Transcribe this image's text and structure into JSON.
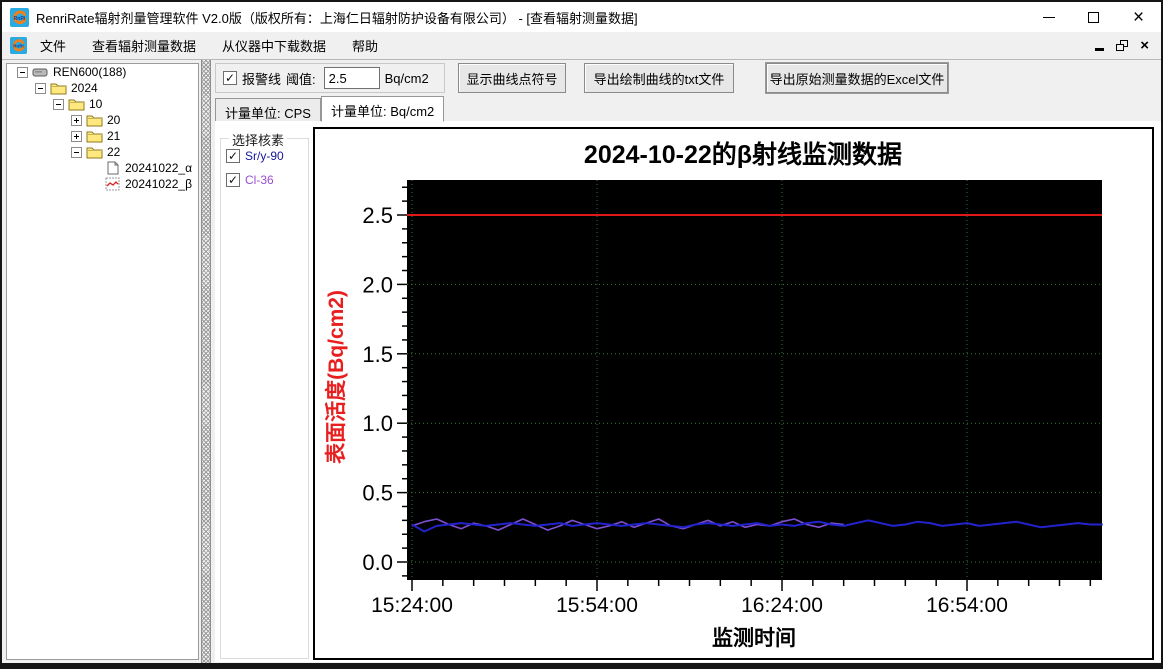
{
  "window": {
    "title": "RenriRate辐射剂量管理软件 V2.0版（版权所有：上海仁日辐射防护设备有限公司） - [查看辐射测量数据]"
  },
  "icons": {
    "check": "✓",
    "close": "×",
    "expand_minus": "-",
    "expand_plus": "+"
  },
  "menu": {
    "items": [
      "文件",
      "查看辐射测量数据",
      "从仪器中下载数据",
      "帮助"
    ]
  },
  "tree": {
    "items": [
      {
        "level": 0,
        "expand": "minus",
        "icon": "device",
        "label": "REN600(188)"
      },
      {
        "level": 1,
        "expand": "minus",
        "icon": "folder",
        "label": "2024"
      },
      {
        "level": 2,
        "expand": "minus",
        "icon": "folder",
        "label": "10"
      },
      {
        "level": 3,
        "expand": "plus",
        "icon": "folder",
        "label": "20"
      },
      {
        "level": 3,
        "expand": "plus",
        "icon": "folder",
        "label": "21"
      },
      {
        "level": 3,
        "expand": "minus",
        "icon": "folder",
        "label": "22"
      },
      {
        "level": 4,
        "expand": "none",
        "icon": "doc",
        "label": "20241022_α"
      },
      {
        "level": 4,
        "expand": "none",
        "icon": "chart",
        "label": "20241022_β"
      }
    ]
  },
  "controls": {
    "alarm_label": "报警线",
    "alarm_checked": true,
    "threshold_label": "阈值:",
    "threshold_value": "2.5",
    "threshold_unit": "Bq/cm2",
    "show_points_button": "显示曲线点符号",
    "export_txt_button": "导出绘制曲线的txt文件",
    "export_excel_button": "导出原始测量数据的Excel文件"
  },
  "tabs": [
    {
      "label": "计量单位: CPS",
      "selected": false
    },
    {
      "label": "计量单位: Bq/cm2",
      "selected": true
    }
  ],
  "nuclide_panel": {
    "title": "选择核素",
    "items": [
      {
        "label": "Sr/y-90",
        "checked": true,
        "color": "#16169c"
      },
      {
        "label": "Cl-36",
        "checked": true,
        "color": "#9a4fd0"
      }
    ]
  },
  "chart_data": {
    "type": "line",
    "title": "2024-10-22的β射线监测数据",
    "xlabel": "监测时间",
    "ylabel": "表面活度(Bq/cm2)",
    "ylabel_color": "#e81f1f",
    "plot_bg": "#000000",
    "grid_color": "#2f7d2f",
    "ylim": [
      -0.13,
      2.75
    ],
    "yticks": [
      0.0,
      0.5,
      1.0,
      1.5,
      2.0,
      2.5
    ],
    "y_minor_step": 0.1,
    "xticks": [
      "15:24:00",
      "15:54:00",
      "16:24:00",
      "16:54:00"
    ],
    "x_major_minutes": 30,
    "x_minor_minutes": 5,
    "x_span_minutes": 112,
    "alarm_line": {
      "value": 2.5,
      "color": "#e01818"
    },
    "series": [
      {
        "name": "Cl-36",
        "color": "#7d4fd2",
        "t_step_minutes": 2,
        "values": [
          0.26,
          0.29,
          0.31,
          0.27,
          0.24,
          0.28,
          0.26,
          0.23,
          0.27,
          0.31,
          0.27,
          0.23,
          0.26,
          0.3,
          0.27,
          0.24,
          0.26,
          0.29,
          0.25,
          0.28,
          0.31,
          0.26,
          0.24,
          0.27,
          0.3,
          0.26,
          0.29,
          0.25,
          0.27,
          0.26,
          0.29,
          0.31,
          0.27,
          0.25,
          0.28,
          0.27
        ]
      },
      {
        "name": "Sr/y-90",
        "color": "#2323cd",
        "t_step_minutes": 2,
        "values": [
          0.27,
          0.22,
          0.26,
          0.27,
          0.28,
          0.27,
          0.26,
          0.27,
          0.28,
          0.27,
          0.26,
          0.27,
          0.28,
          0.26,
          0.27,
          0.28,
          0.27,
          0.26,
          0.27,
          0.28,
          0.27,
          0.26,
          0.25,
          0.27,
          0.28,
          0.27,
          0.26,
          0.27,
          0.28,
          0.26,
          0.27,
          0.26,
          0.28,
          0.29,
          0.27,
          0.26,
          0.28,
          0.3,
          0.28,
          0.26,
          0.27,
          0.29,
          0.28,
          0.26,
          0.27,
          0.28,
          0.26,
          0.27,
          0.28,
          0.29,
          0.27,
          0.25,
          0.26,
          0.27,
          0.28,
          0.27,
          0.27
        ]
      }
    ]
  }
}
